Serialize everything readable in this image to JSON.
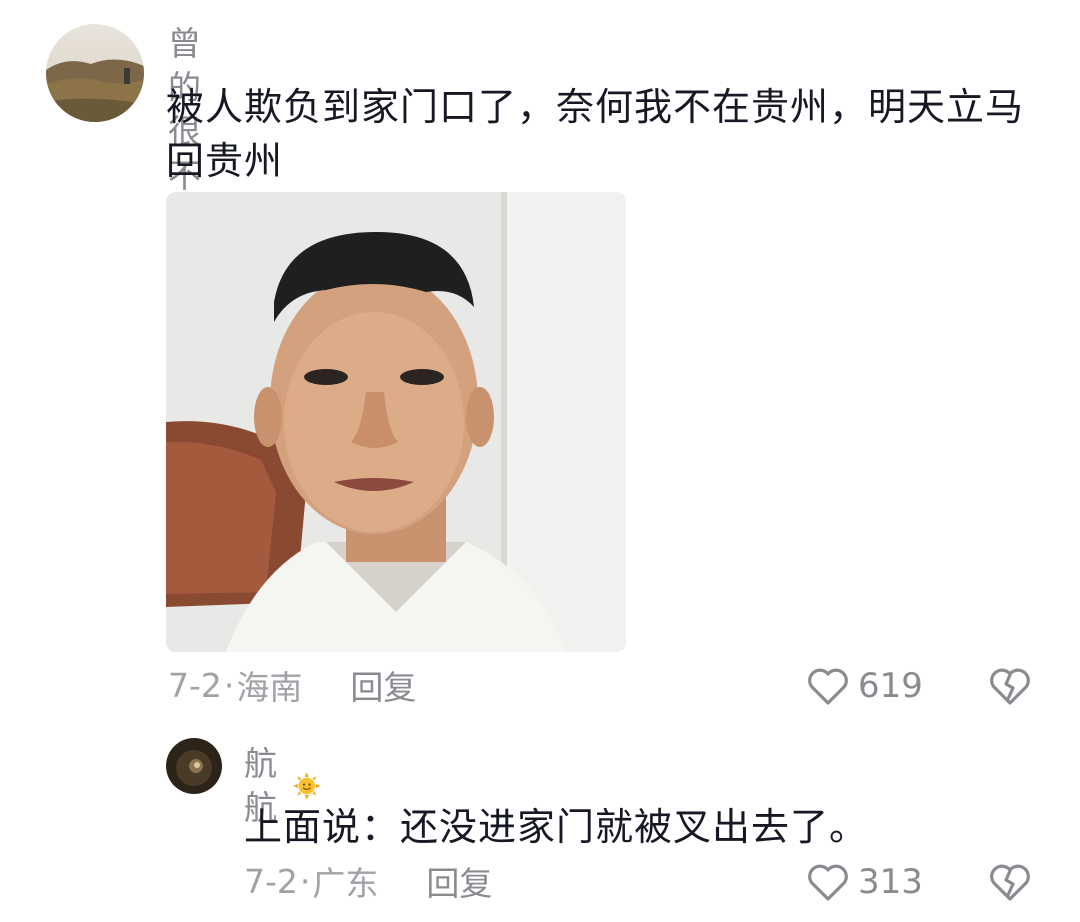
{
  "comments": [
    {
      "username": "曾的很不错",
      "text": "被人欺负到家门口了，奈何我不在贵州，明天立马回贵州",
      "date": "7-2",
      "location": "海南",
      "reply_label": "回复",
      "likes": "619",
      "icons": {
        "like": "heart-outline-icon",
        "dislike": "broken-heart-icon"
      }
    },
    {
      "username": "航航",
      "badge_icon": "sun-emoji-icon",
      "text": "上面说：还没进家门就被叉出去了。",
      "date": "7-2",
      "location": "广东",
      "reply_label": "回复",
      "likes": "313",
      "icons": {
        "like": "heart-outline-icon",
        "dislike": "broken-heart-icon"
      }
    }
  ],
  "meta_separator": "·",
  "colors": {
    "text_primary": "#161823",
    "text_secondary": "#8a8b91",
    "background": "#ffffff"
  }
}
